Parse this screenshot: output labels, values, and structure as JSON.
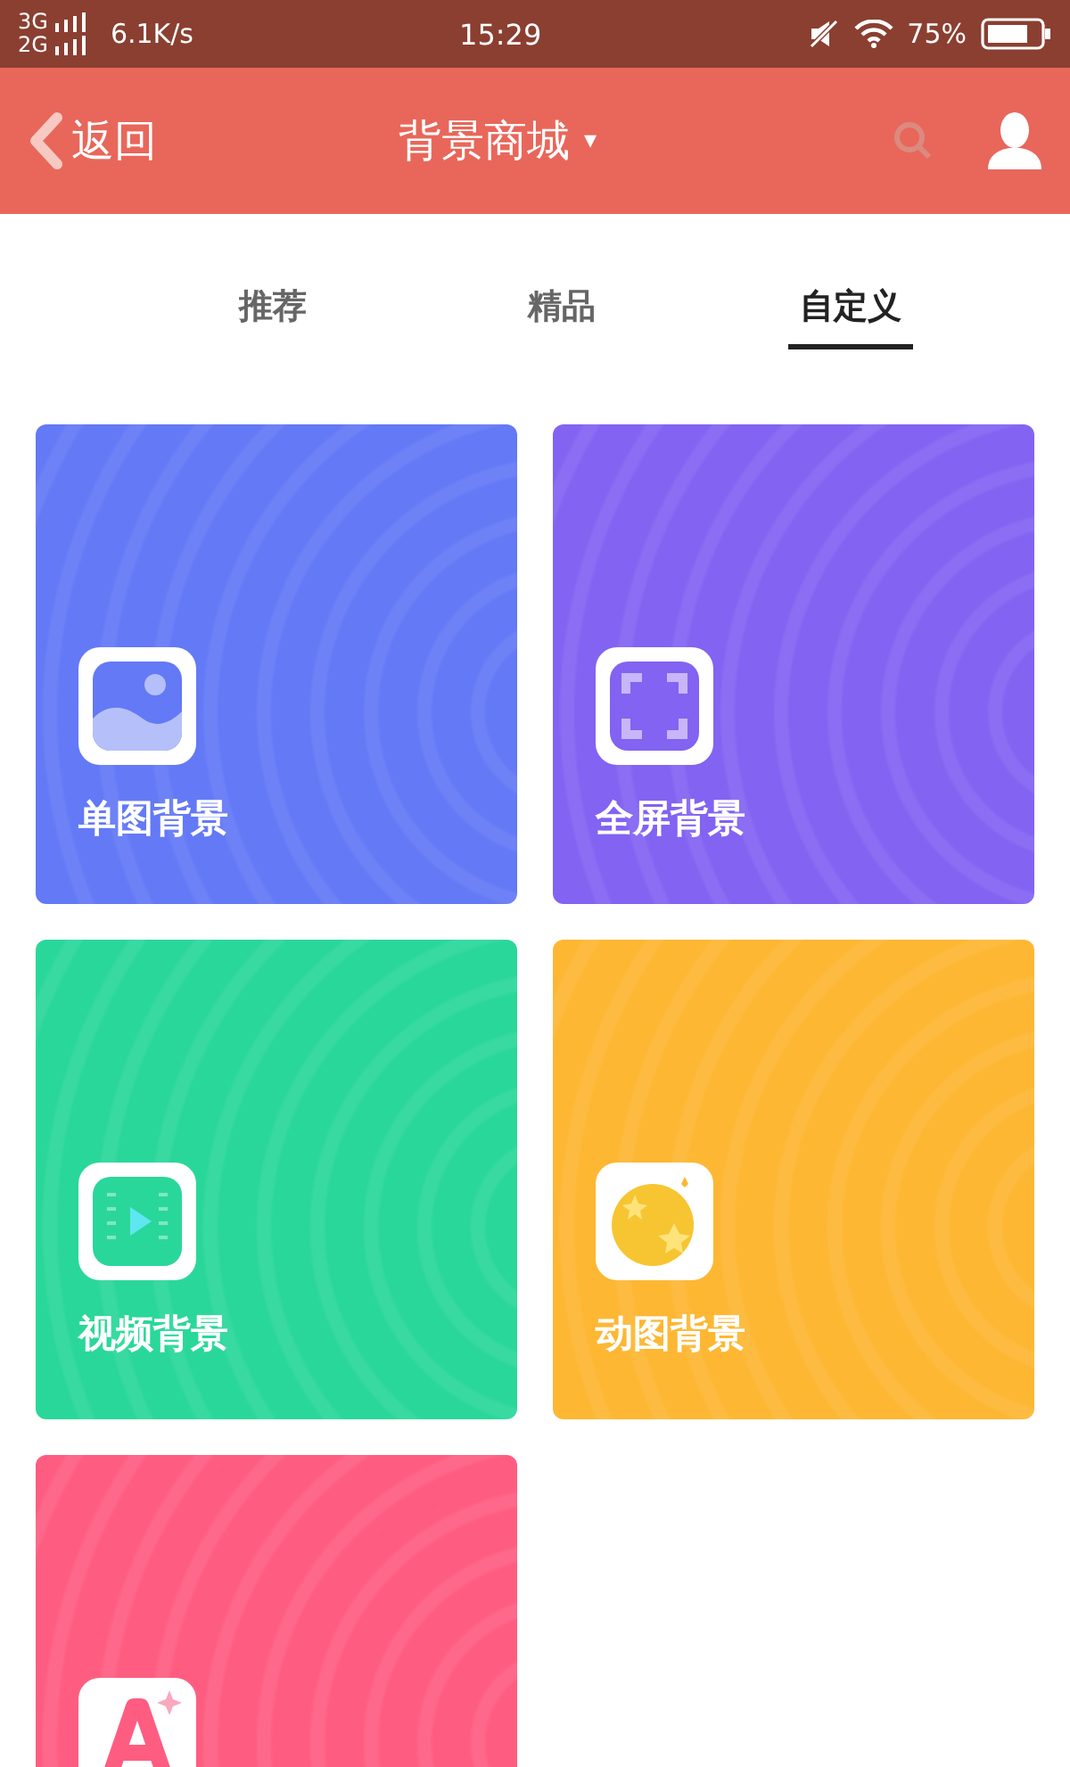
{
  "status_bar": {
    "network_top": "3G",
    "network_bottom": "2G",
    "speed": "6.1K/s",
    "time": "15:29",
    "battery": "75%"
  },
  "header": {
    "back": "返回",
    "title": "背景商城",
    "dropdown": "▾"
  },
  "tabs": [
    {
      "label": "推荐",
      "selected": false
    },
    {
      "label": "精品",
      "selected": false
    },
    {
      "label": "自定义",
      "selected": true
    }
  ],
  "cards": [
    {
      "kind": "image",
      "label": "单图背景",
      "color": "#6379f6"
    },
    {
      "kind": "fullscreen",
      "label": "全屏背景",
      "color": "#8263f2"
    },
    {
      "kind": "video",
      "label": "视频背景",
      "color": "#2ad79b"
    },
    {
      "kind": "gif",
      "label": "动图背景",
      "color": "#fdb733"
    },
    {
      "kind": "font",
      "color": "#fe5d81"
    }
  ]
}
